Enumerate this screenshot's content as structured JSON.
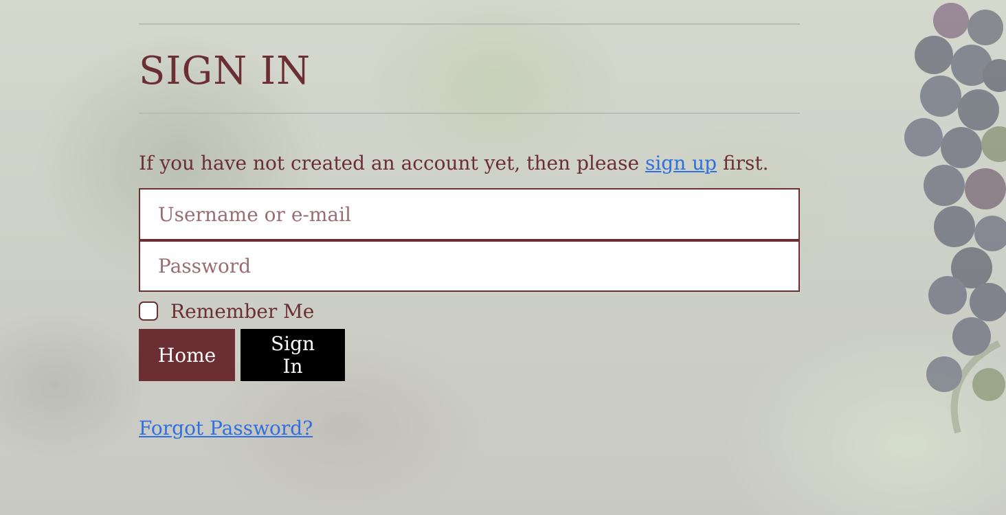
{
  "page": {
    "title": "SIGN IN",
    "intro_prefix": "If you have not created an account yet, then please ",
    "signup_link": "sign up",
    "intro_suffix": " first."
  },
  "form": {
    "username_placeholder": "Username or e-mail",
    "username_value": "",
    "password_placeholder": "Password",
    "password_value": "",
    "remember_label": "Remember Me",
    "remember_checked": false
  },
  "buttons": {
    "home_label": "Home",
    "signin_label": "Sign In"
  },
  "links": {
    "forgot_password": "Forgot Password?"
  },
  "colors": {
    "brand": "#6b2e33",
    "link": "#2f6fe0",
    "signin_bg": "#000000"
  }
}
